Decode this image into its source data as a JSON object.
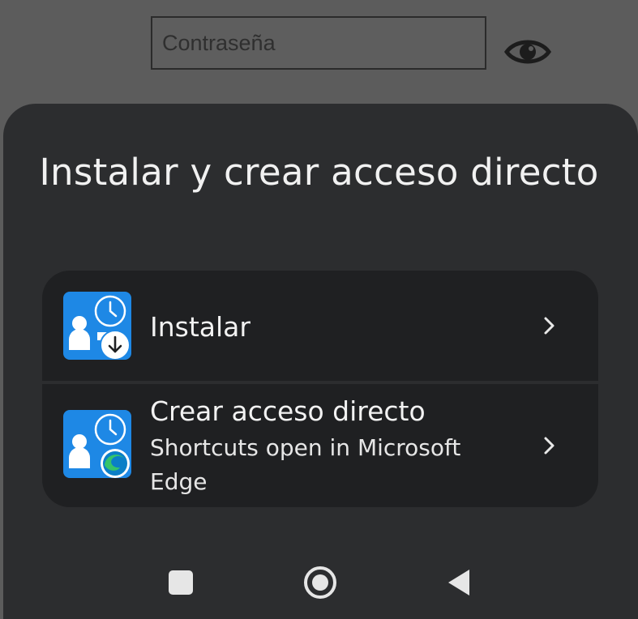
{
  "background_page": {
    "password_placeholder": "Contraseña",
    "show_password_icon": "eye-icon"
  },
  "sheet": {
    "title": "Instalar y crear acceso directo",
    "options": [
      {
        "label": "Instalar",
        "icon": "app-icon-with-download-badge"
      },
      {
        "label": "Crear acceso directo",
        "sublabel": "Shortcuts open in Microsoft Edge",
        "icon": "app-icon-with-edge-badge"
      }
    ]
  },
  "navbar": {
    "recents_icon": "square-icon",
    "home_icon": "circle-icon",
    "back_icon": "triangle-back-icon"
  },
  "colors": {
    "sheet_background": "#2c2d2f",
    "options_background": "#1f2022",
    "app_icon_blue": "#1e88e5",
    "dimmed_page": "#5c5c5c"
  }
}
